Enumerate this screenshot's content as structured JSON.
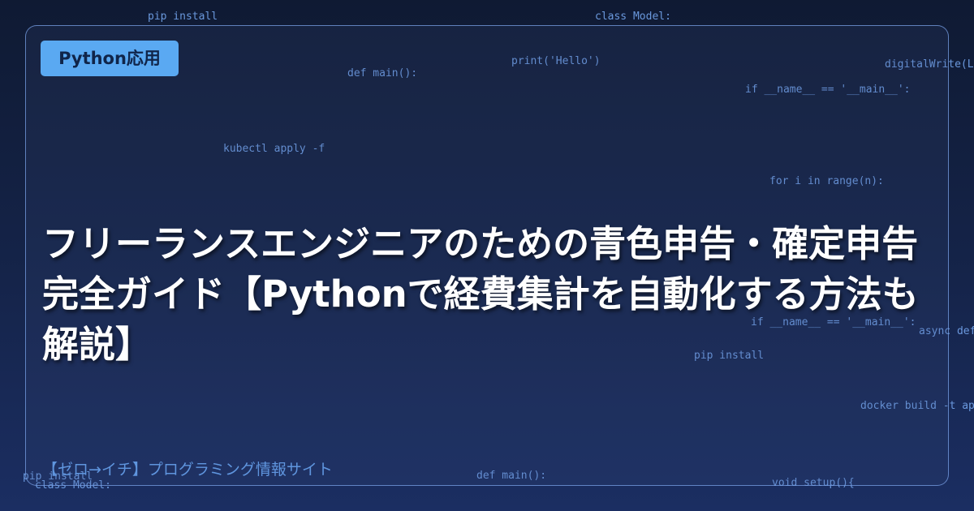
{
  "background_code": [
    "pip install",
    "class Model:",
    "print('Hello')",
    "digitalWrite(L",
    "def main():",
    "if __name__ == '__main__':",
    "kubectl apply -f",
    "for i in range(n):",
    "if __name__ == '__main__':",
    "async def",
    "pip install",
    "docker build -t ap",
    "pip install",
    "class Model:",
    "def main():",
    "void setup(){"
  ],
  "badge": {
    "label": "Python応用",
    "color": "#5aa9f2"
  },
  "title": "フリーランスエンジニアのための青色申告・確定申告完全ガイド【Pythonで経費集計を自動化する方法も解説】",
  "site_name": "【ゼロ→イチ】プログラミング情報サイト",
  "colors": {
    "background_top": "#0f1a33",
    "background_bottom": "#1b2e62",
    "code_text": "#6f9fe6",
    "title_text": "#ffffff",
    "site_name_text": "#5f95de"
  }
}
